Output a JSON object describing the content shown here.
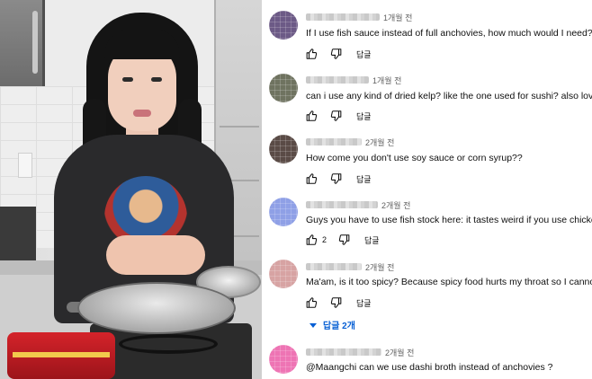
{
  "comments": [
    {
      "time": "1개월 전",
      "text": "If I use fish sauce instead of full anchovies, how much would I need? (",
      "like_count": "",
      "reply_label": "답글",
      "avatar_color": "#6c5a86"
    },
    {
      "time": "1개월 전",
      "text": "can i use any kind of dried kelp? like the one used for sushi? also love",
      "like_count": "",
      "reply_label": "답글",
      "avatar_color": "#6f7360"
    },
    {
      "time": "2개월 전",
      "text": "How come you don't use soy sauce or corn syrup??",
      "like_count": "",
      "reply_label": "답글",
      "avatar_color": "#5a4b46"
    },
    {
      "time": "2개월 전",
      "text": "Guys you have to use fish stock here: it tastes weird if you use chicken",
      "like_count": "2",
      "reply_label": "답글",
      "avatar_color": "#8fa0e6"
    },
    {
      "time": "2개월 전",
      "text": "Ma'am, is it too spicy? Because spicy food hurts my throat so I cannot",
      "like_count": "",
      "reply_label": "답글",
      "avatar_color": "#d7a3a3"
    },
    {
      "time": "2개월 전",
      "text": "@Maangchi can we use dashi broth instead of anchovies ?",
      "like_count": "",
      "reply_label": "",
      "avatar_color": "#ee74b4"
    }
  ],
  "replies_toggle": {
    "label": "답글 2개",
    "color": "#065fd4"
  },
  "icons": {
    "like": "thumb-up-icon",
    "dislike": "thumb-down-icon",
    "expand": "caret-down-icon"
  }
}
